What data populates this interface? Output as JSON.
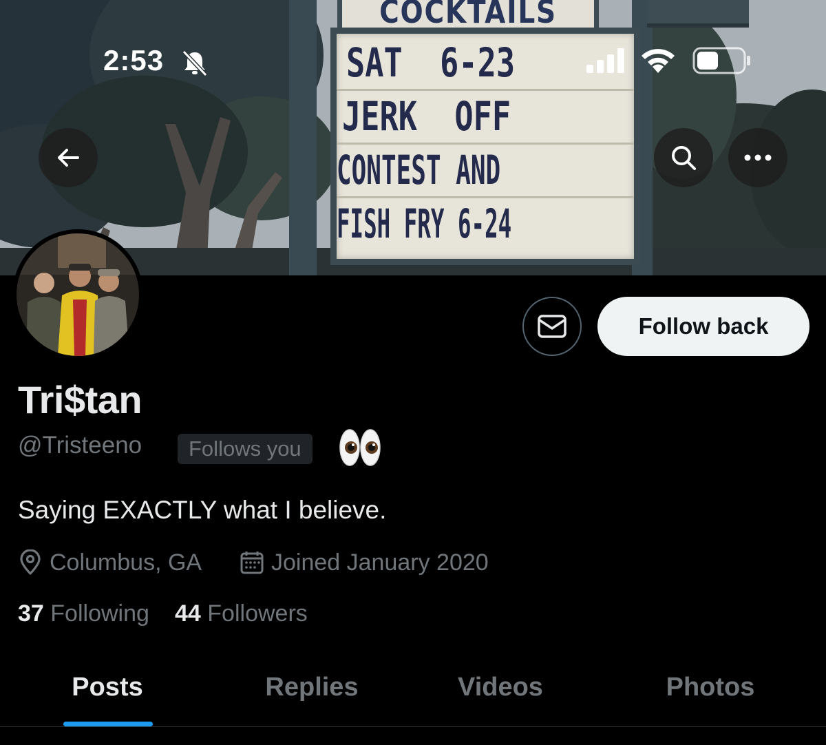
{
  "status_bar": {
    "time": "2:53",
    "icons": [
      "bell-slash-icon",
      "cellular-signal-icon",
      "wifi-icon",
      "battery-icon"
    ]
  },
  "banner": {
    "sign_header": "COCKTAILS",
    "sign_lines": [
      "SAT  6-23",
      "JERK  OFF",
      "CONTEST AND",
      "FISH FRY 6-24"
    ]
  },
  "header_actions": {
    "back_icon": "arrow-left-icon",
    "search_icon": "search-icon",
    "more_icon": "more-horizontal-icon"
  },
  "profile": {
    "display_name": "Tri$tan",
    "handle": "@Tristeeno",
    "follows_you_badge": "Follows you",
    "handle_emoji": "👀",
    "bio": "Saying EXACTLY what I believe.",
    "location": "Columbus, GA",
    "joined": "Joined January 2020",
    "following_count": "37",
    "following_label": "Following",
    "followers_count": "44",
    "followers_label": "Followers"
  },
  "actions": {
    "message_icon": "envelope-icon",
    "follow_back_label": "Follow back"
  },
  "tabs": [
    {
      "label": "Posts",
      "active": true
    },
    {
      "label": "Replies",
      "active": false
    },
    {
      "label": "Videos",
      "active": false
    },
    {
      "label": "Photos",
      "active": false
    }
  ],
  "colors": {
    "background": "#000000",
    "primary_text": "#e7e9ea",
    "secondary_text": "#71767b",
    "accent": "#1d9bf0",
    "follow_button_bg": "#eff3f4"
  }
}
